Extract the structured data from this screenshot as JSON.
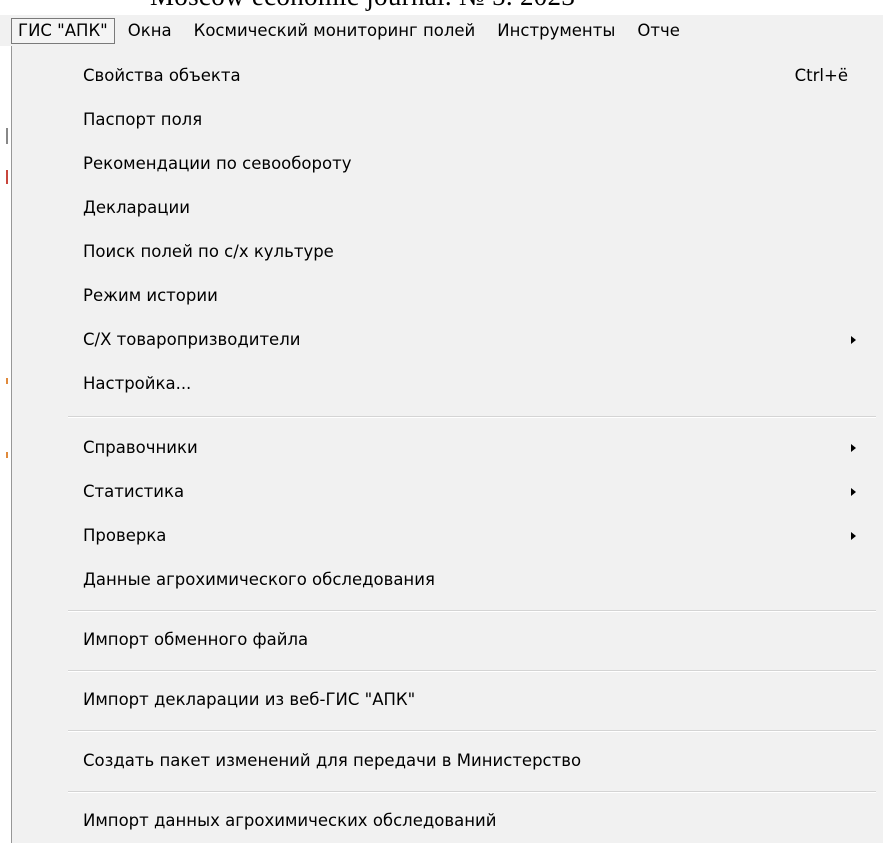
{
  "background_caption": "Moscow economic journal. № 5. 2023",
  "menubar": {
    "items": [
      {
        "label": "ГИС \"АПК\"",
        "active": true
      },
      {
        "label": "Окна"
      },
      {
        "label": "Космический мониторинг полей"
      },
      {
        "label": "Инструменты"
      },
      {
        "label": "Отче"
      }
    ]
  },
  "menu": {
    "items": [
      {
        "label": "Свойства объекта",
        "shortcut": "Ctrl+ё"
      },
      {
        "label": "Паспорт поля"
      },
      {
        "label": "Рекомендации по севообороту"
      },
      {
        "label": "Декларации"
      },
      {
        "label": "Поиск полей по с/х культуре"
      },
      {
        "label": "Режим истории"
      },
      {
        "label": "С/Х товаропризводители",
        "submenu": true
      },
      {
        "label": "Настройка..."
      },
      {
        "label": "Справочники",
        "submenu": true
      },
      {
        "label": "Статистика",
        "submenu": true
      },
      {
        "label": "Проверка",
        "submenu": true
      },
      {
        "label": "Данные агрохимического обследования"
      },
      {
        "label": "Импорт обменного файла"
      },
      {
        "label": "Импорт декларации из веб-ГИС \"АПК\""
      },
      {
        "label": "Создать пакет изменений для передачи в Министерство"
      },
      {
        "label": "Импорт данных агрохимических обследований"
      }
    ]
  },
  "colors": {
    "menu_background": "#f1f1f1",
    "menu_border": "#979797",
    "separator": "#d4d4d4",
    "text": "#000000",
    "side_mark_red": "#c8463c",
    "side_mark_orange": "#e08a3c"
  }
}
